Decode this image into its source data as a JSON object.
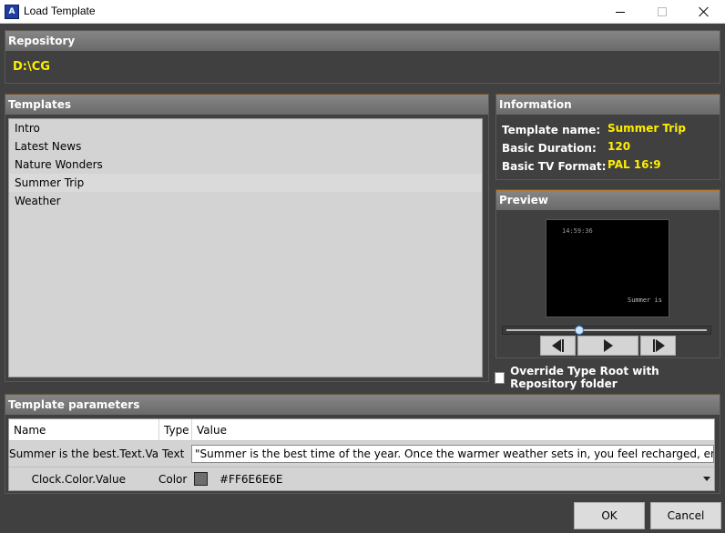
{
  "window": {
    "title": "Load Template",
    "icon_text": "A"
  },
  "repository": {
    "header": "Repository",
    "path": "D:\\CG"
  },
  "templates": {
    "header": "Templates",
    "items": [
      "Intro",
      "Latest News",
      "Nature Wonders",
      "Summer Trip",
      "Weather"
    ],
    "selected_index": 3
  },
  "information": {
    "header": "Information",
    "rows": [
      {
        "label": "Template name:",
        "value": "Summer Trip"
      },
      {
        "label": "Basic Duration:",
        "value": "120"
      },
      {
        "label": "Basic TV Format:",
        "value": "PAL 16:9"
      }
    ]
  },
  "preview": {
    "header": "Preview",
    "timestamp": "14:59:36",
    "caption": "Summer is",
    "slider_position": 0.36
  },
  "override": {
    "label": "Override Type Root with Repository folder",
    "checked": false
  },
  "parameters": {
    "header": "Template parameters",
    "columns": [
      "Name",
      "Type",
      "Value"
    ],
    "rows": [
      {
        "name": "Summer is the best.Text.Value",
        "type": "Text",
        "value": "\"Summer is the best time of the year. Once the warmer weather sets in, you feel recharged, energized, and"
      },
      {
        "name": "Clock.Color.Value",
        "type": "Color",
        "value": "#FF6E6E6E",
        "swatch": "#6e6e6e"
      }
    ]
  },
  "buttons": {
    "ok": "OK",
    "cancel": "Cancel"
  },
  "colors": {
    "accent": "#ffee00",
    "group_border": "#b07a2a",
    "background": "#404040"
  }
}
